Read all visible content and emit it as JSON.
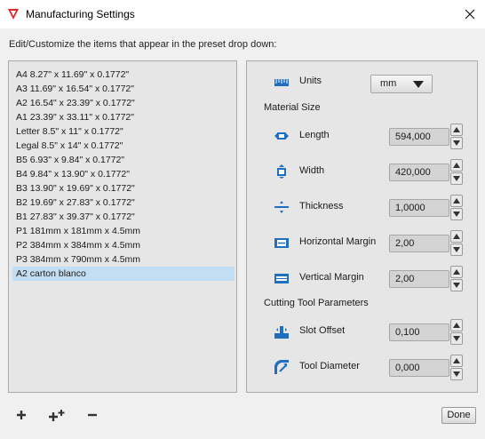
{
  "window": {
    "title": "Manufacturing Settings",
    "close_icon": "close-icon",
    "app_icon": "app-logo-icon",
    "accent_color": "#e0262a"
  },
  "instruction": "Edit/Customize the items that appear in the preset drop down:",
  "presets": {
    "selected_index": 14,
    "selected_color": "#c3def2",
    "items": [
      "A4 8.27\" x 11.69\" x 0.1772\"",
      "A3 11.69\" x 16.54\" x 0.1772\"",
      "A2 16.54\" x 23.39\" x 0.1772\"",
      "A1 23.39\" x 33.11\" x 0.1772\"",
      "Letter 8.5\" x 11\" x 0.1772\"",
      "Legal 8.5\" x 14\" x 0.1772\"",
      "B5 6.93\" x 9.84\" x 0.1772\"",
      "B4 9.84\" x 13.90\" x 0.1772\"",
      "B3 13.90\" x 19.69\" x 0.1772\"",
      "B2 19.69\" x 27.83\" x 0.1772\"",
      "B1 27.83\" x 39.37\" x 0.1772\"",
      "P1 181mm x 181mm x 4.5mm",
      "P2 384mm x 384mm x 4.5mm",
      "P3 384mm x 790mm x 4.5mm",
      "A2 carton blanco"
    ]
  },
  "settings": {
    "units": {
      "label": "Units",
      "value": "mm",
      "icon": "ruler-icon"
    },
    "material_size_heading": "Material Size",
    "length": {
      "label": "Length",
      "value": "594,000",
      "icon": "length-icon"
    },
    "width": {
      "label": "Width",
      "value": "420,000",
      "icon": "width-icon"
    },
    "thickness": {
      "label": "Thickness",
      "value": "1,0000",
      "icon": "thickness-icon"
    },
    "horizontal_margin": {
      "label": "Horizontal Margin",
      "value": "2,00",
      "icon": "horizontal-margin-icon"
    },
    "vertical_margin": {
      "label": "Vertical Margin",
      "value": "2,00",
      "icon": "vertical-margin-icon"
    },
    "cutting_tool_heading": "Cutting Tool Parameters",
    "slot_offset": {
      "label": "Slot Offset",
      "value": "0,100",
      "icon": "slot-offset-icon"
    },
    "tool_diameter": {
      "label": "Tool Diameter",
      "value": "0,000",
      "icon": "tool-diameter-icon"
    }
  },
  "footer": {
    "add_icon": "add-icon",
    "add_multiple_icon": "add-multiple-icon",
    "remove_icon": "remove-icon",
    "done_label": "Done"
  },
  "colors": {
    "icon_blue": "#1f6fc0",
    "panel_bg": "#e6e6e6",
    "field_bg": "#d4d4d4"
  }
}
